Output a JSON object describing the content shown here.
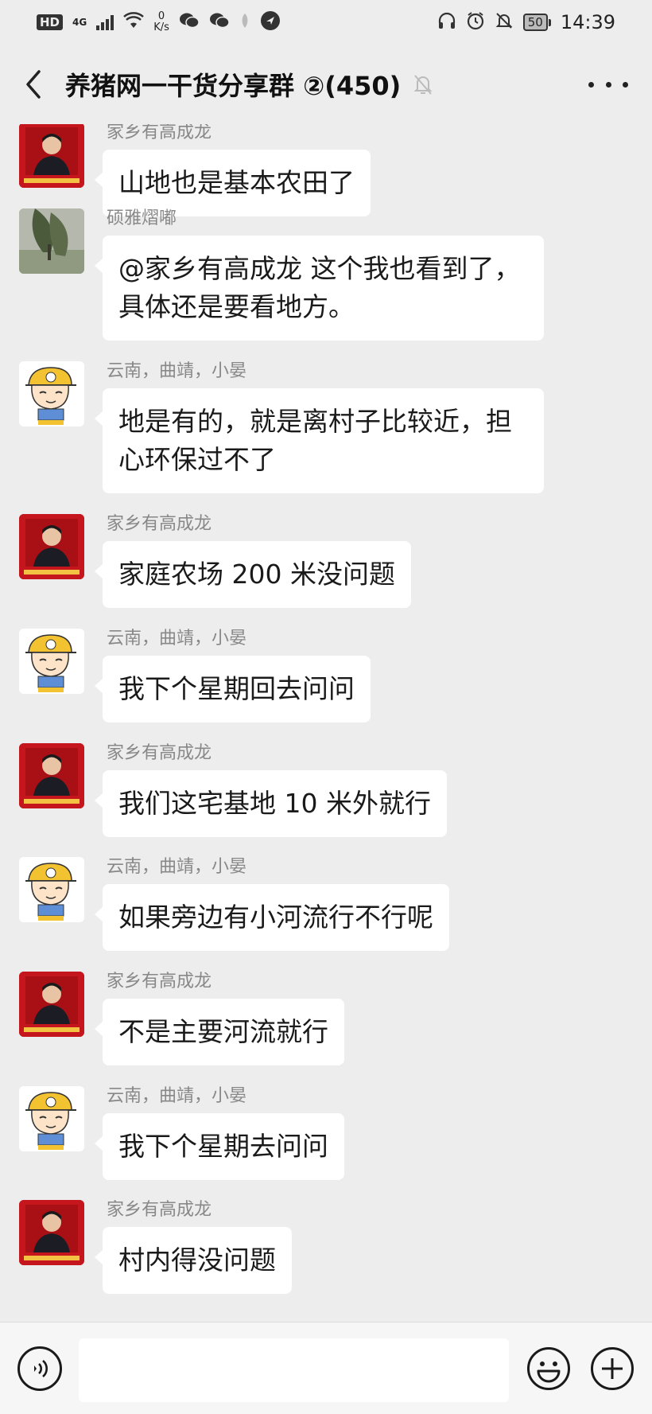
{
  "status_bar": {
    "hd_badge": "HD",
    "network": "4G",
    "speed_value": "0",
    "speed_unit": "K/s",
    "battery": "50",
    "time": "14:39"
  },
  "header": {
    "title": "养猪网一干货分享群 ②(450)",
    "icons": [
      "back-arrow",
      "mute-bell",
      "more-dots"
    ]
  },
  "messages": [
    {
      "sender": "家乡有高成龙",
      "avatar": "man-red",
      "text": "山地也是基本农田了"
    },
    {
      "sender": "硕雅熠嘟",
      "avatar": "tree-photo",
      "text": "@家乡有高成龙  这个我也看到了，具体还是要看地方。"
    },
    {
      "sender": "云南，曲靖，小晏",
      "avatar": "cartoon-boy",
      "text": "地是有的，就是离村子比较近，担心环保过不了"
    },
    {
      "sender": "家乡有高成龙",
      "avatar": "man-red",
      "text": "家庭农场 200 米没问题"
    },
    {
      "sender": "云南，曲靖，小晏",
      "avatar": "cartoon-boy",
      "text": "我下个星期回去问问"
    },
    {
      "sender": "家乡有高成龙",
      "avatar": "man-red",
      "text": "我们这宅基地 10 米外就行"
    },
    {
      "sender": "云南，曲靖，小晏",
      "avatar": "cartoon-boy",
      "text": "如果旁边有小河流行不行呢"
    },
    {
      "sender": "家乡有高成龙",
      "avatar": "man-red",
      "text": "不是主要河流就行"
    },
    {
      "sender": "云南，曲靖，小晏",
      "avatar": "cartoon-boy",
      "text": "我下个星期去问问"
    },
    {
      "sender": "家乡有高成龙",
      "avatar": "man-red",
      "text": "村内得没问题"
    }
  ],
  "input_bar": {
    "value": "",
    "icons": [
      "voice-icon",
      "emoji-icon",
      "plus-icon"
    ]
  }
}
